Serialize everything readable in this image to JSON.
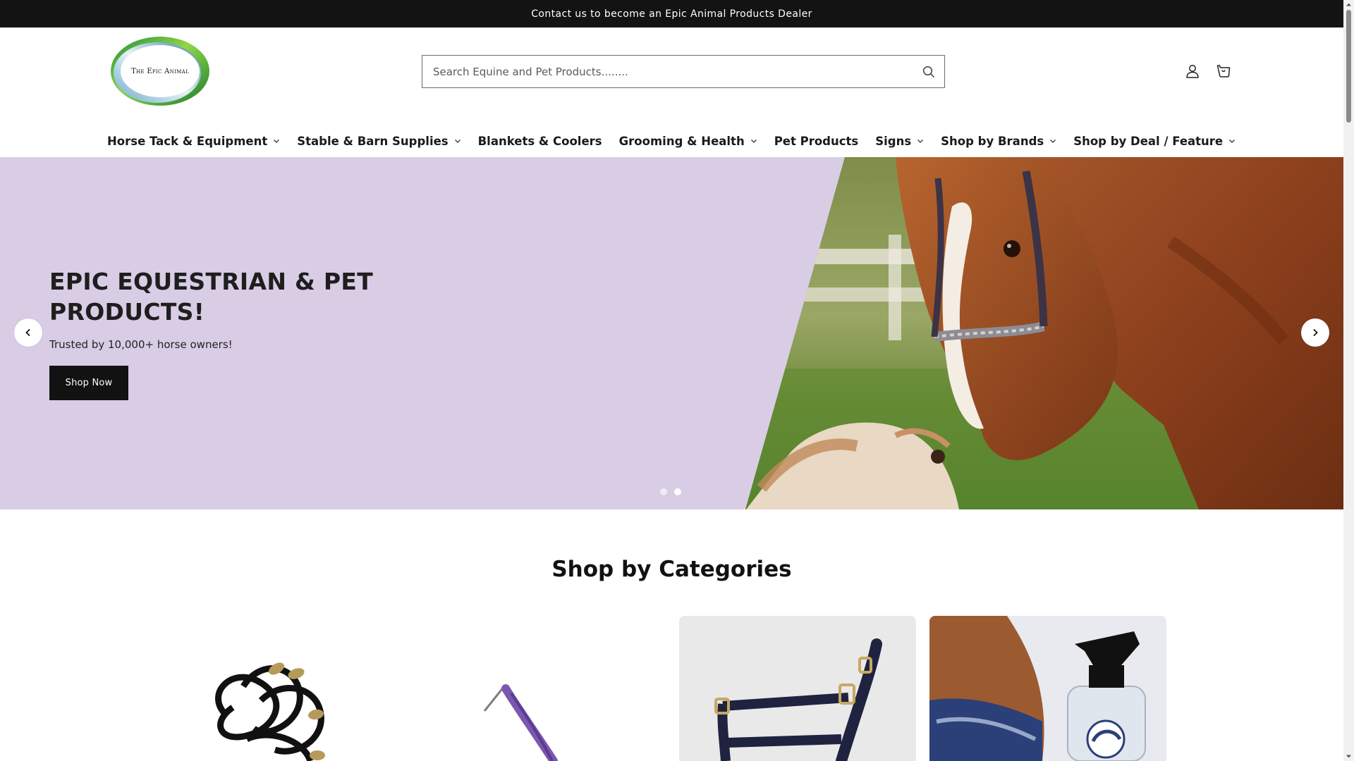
{
  "announcement": "Contact us to become an Epic Animal Products Dealer",
  "logo": {
    "text": "The Epic Animal"
  },
  "search": {
    "placeholder": "Search Equine and Pet Products........"
  },
  "nav": [
    {
      "label": "Horse Tack & Equipment",
      "dropdown": true
    },
    {
      "label": "Stable & Barn Supplies",
      "dropdown": true
    },
    {
      "label": "Blankets & Coolers",
      "dropdown": false
    },
    {
      "label": "Grooming & Health",
      "dropdown": true
    },
    {
      "label": "Pet Products",
      "dropdown": false
    },
    {
      "label": "Signs",
      "dropdown": true
    },
    {
      "label": "Shop by Brands",
      "dropdown": true
    },
    {
      "label": "Shop by Deal / Feature",
      "dropdown": true
    }
  ],
  "hero": {
    "title": "EPIC EQUESTRIAN & PET PRODUCTS!",
    "subtitle": "Trusted by 10,000+ horse owners!",
    "button": "Shop Now",
    "slide_count": 2,
    "active_slide": 2
  },
  "categories": {
    "title": "Shop by Categories"
  },
  "colors": {
    "announcement_bg": "#131313",
    "hero_bg": "#d9cde5",
    "button_bg": "#121212"
  },
  "icons": [
    "search-icon",
    "account-icon",
    "cart-icon",
    "chevron-down-icon",
    "chevron-left-icon",
    "chevron-right-icon"
  ]
}
